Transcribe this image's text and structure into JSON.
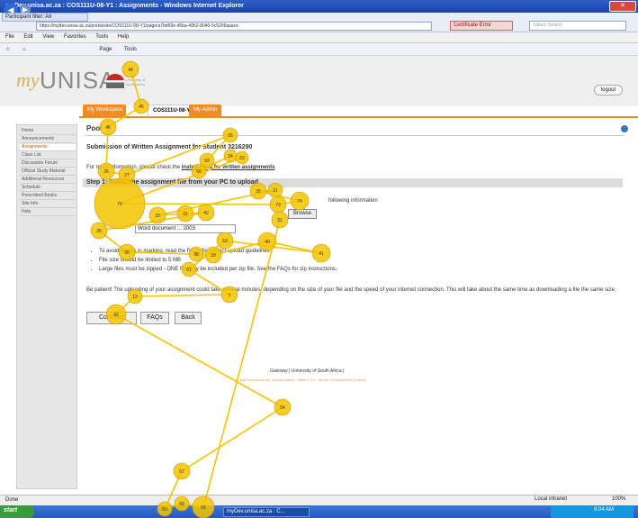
{
  "browser": {
    "window_title": "myDev.unisa.ac.za : COS111U-08-Y1 : Assignments - Windows Internet Explorer",
    "tab_label": "Participant filter: All",
    "url": "https://mydev.unisa.ac.za/portal/site/COS111U-08-Y1/page/a7bd69e-d5ba-4952-8040-5c5206aaace",
    "certificate": "Certificate Error",
    "search_placeholder": "Yahoo! Search",
    "menu": [
      "File",
      "Edit",
      "View",
      "Favorites",
      "Tools",
      "Help"
    ],
    "command": [
      "Page",
      "Tools"
    ]
  },
  "header": {
    "logo_my": "my",
    "logo_unisa": "UNISA",
    "logo_sub": "university of south africa",
    "logout": "logout"
  },
  "tabs": [
    {
      "label": "My Workspace"
    },
    {
      "label": "COS111U-08-Y1"
    },
    {
      "label": "My Admin"
    }
  ],
  "sidebar": {
    "items": [
      {
        "label": "Home"
      },
      {
        "label": "Announcements"
      },
      {
        "label": "Assignments"
      },
      {
        "label": "Class List"
      },
      {
        "label": "Discussion Forum"
      },
      {
        "label": "Official Study Material"
      },
      {
        "label": "Additional Resources"
      },
      {
        "label": "Schedule"
      },
      {
        "label": "Prescribed Books"
      },
      {
        "label": "Site Info"
      },
      {
        "label": "Help"
      }
    ]
  },
  "main": {
    "tool_title": "Pool",
    "sub_title": "Submission of Written Assignment for Student 3216290",
    "intro_text": "For more information, please check the",
    "intro_link": "instructions for written assignments",
    "step1": "Step 1: Select the assignment file from your PC to upload",
    "step_text": "following information",
    "doc_field_value": "Word document ... 2003",
    "browse": "Browse",
    "guidelines": [
      "To avoid delays in marking, read the FAQs for correct upload guidelines",
      "File size should be limited to 5 MB",
      "Large files must be zipped - ONE file may be included per zip file. See the FAQs for zip instructions."
    ],
    "patient_text": "Be patient! The uploading of your assignment could take several minutes, depending on the size of your file and the speed of your internet connection. This will take about the same time as downloading a file the same size.",
    "buttons": {
      "continue": "Continue",
      "faqs": "FAQs",
      "back": "Back"
    }
  },
  "footer": {
    "links": "Gateway | University of South Africa |",
    "sub": "myDev.unisa.ac.za - Development - Sakai 2.5.x - Server: Development (Linked)"
  },
  "status": {
    "left": "Done",
    "zone": "Local intranet",
    "zoom": "100%"
  },
  "taskbar": {
    "start": "start",
    "item": "myDev.unisa.ac.za : C...",
    "clock": "9:04 AM"
  },
  "gaze": {
    "color": "#f5c400",
    "fixations": [
      {
        "n": "44"
      },
      {
        "n": "45"
      },
      {
        "n": "46"
      },
      {
        "n": "26"
      },
      {
        "n": "27"
      },
      {
        "n": "55"
      },
      {
        "n": "59"
      },
      {
        "n": "60"
      },
      {
        "n": "24"
      },
      {
        "n": "23"
      },
      {
        "n": "72"
      },
      {
        "n": "73"
      },
      {
        "n": "74"
      },
      {
        "n": "25"
      },
      {
        "n": "21"
      },
      {
        "n": "33"
      },
      {
        "n": "31"
      },
      {
        "n": "42"
      },
      {
        "n": "35"
      },
      {
        "n": "36"
      },
      {
        "n": "38"
      },
      {
        "n": "39"
      },
      {
        "n": "40"
      },
      {
        "n": "41"
      },
      {
        "n": "53"
      },
      {
        "n": "61"
      },
      {
        "n": "1"
      },
      {
        "n": "12"
      },
      {
        "n": "42"
      },
      {
        "n": "54"
      },
      {
        "n": "67"
      },
      {
        "n": "69"
      },
      {
        "n": "68"
      },
      {
        "n": "66"
      },
      {
        "n": "52"
      }
    ]
  }
}
